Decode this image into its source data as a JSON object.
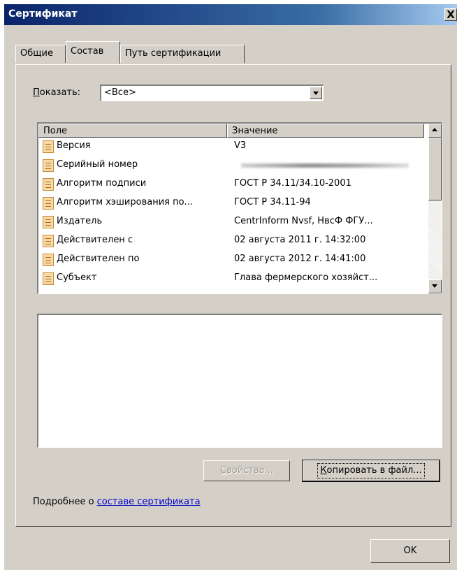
{
  "window": {
    "title": "Сертификат",
    "close_label": "X"
  },
  "tabs": [
    {
      "label": "Общие",
      "active": false
    },
    {
      "label": "Состав",
      "active": true
    },
    {
      "label": "Путь сертификации",
      "active": false
    }
  ],
  "filter": {
    "label_hotkey": "П",
    "label_rest": "оказать:",
    "selected": "<Все>"
  },
  "table": {
    "columns": [
      "Поле",
      "Значение"
    ],
    "rows": [
      {
        "field": "Версия",
        "value": "V3"
      },
      {
        "field": "Серийный номер",
        "value": ""
      },
      {
        "field": "Алгоритм подписи",
        "value": "ГОСТ Р 34.11/34.10-2001"
      },
      {
        "field": "Алгоритм хэширования по...",
        "value": "ГОСТ Р 34.11-94"
      },
      {
        "field": "Издатель",
        "value": "CentrInform Nvsf, НвсФ ФГУ..."
      },
      {
        "field": "Действителен с",
        "value": "02 августа 2011 г. 14:32:00"
      },
      {
        "field": "Действителен по",
        "value": "02 августа 2012 г. 14:41:00"
      },
      {
        "field": "Субъект",
        "value": "Глава фермерского хозяйст..."
      }
    ]
  },
  "buttons": {
    "properties": {
      "hotkey": "С",
      "rest": "войства..."
    },
    "copy_to_file": {
      "hotkey": "К",
      "rest": "опировать в файл..."
    },
    "ok": "OK"
  },
  "more_info": {
    "prefix": "Подробнее о ",
    "link": "составе сертификата"
  }
}
